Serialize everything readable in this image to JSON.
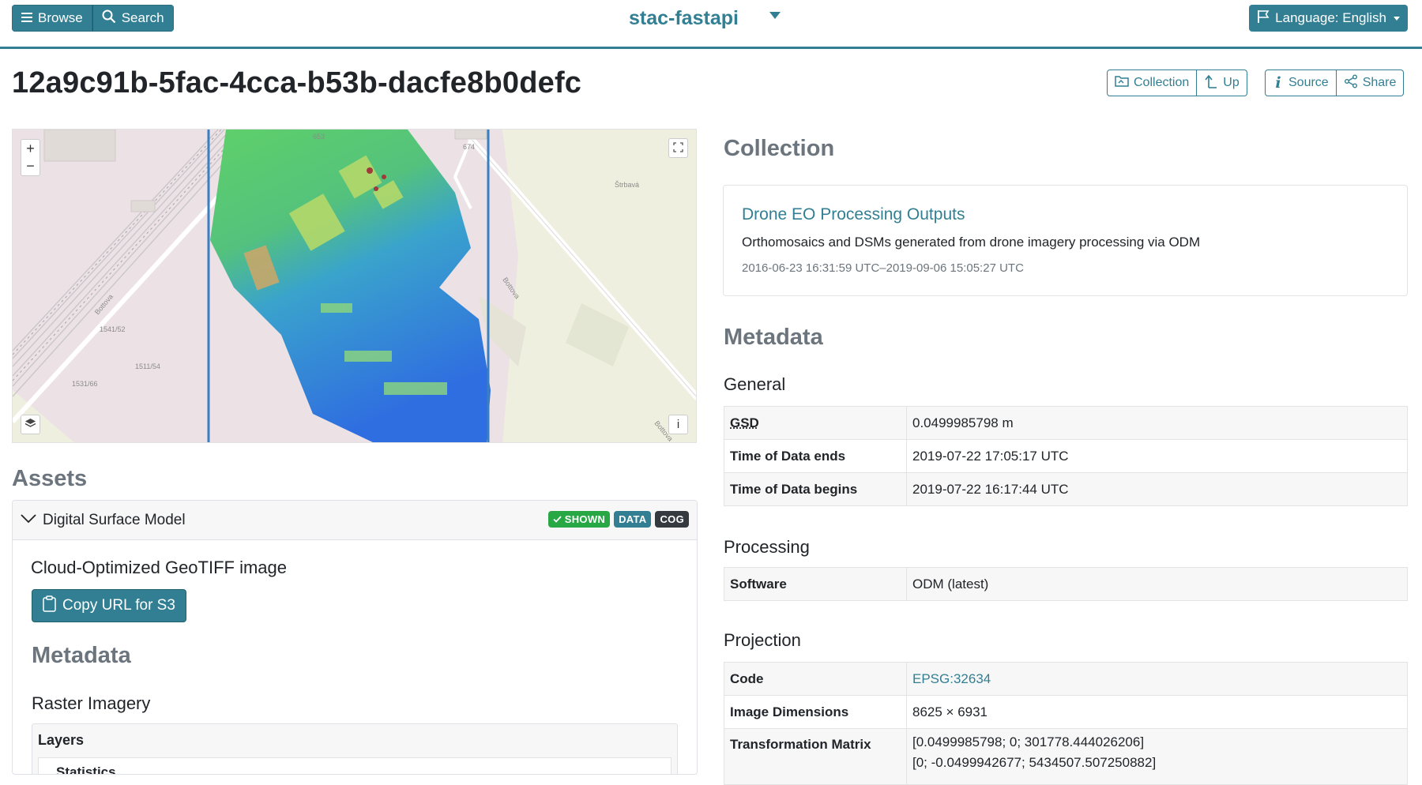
{
  "header": {
    "browse_label": "Browse",
    "search_label": "Search",
    "catalog_title": "stac-fastapi",
    "language_label": "Language: English"
  },
  "page": {
    "title": "12a9c91b-5fac-4cca-b53b-dacfe8b0defc",
    "actions": {
      "collection": "Collection",
      "up": "Up",
      "source": "Source",
      "share": "Share"
    }
  },
  "map": {
    "zoom_in": "+",
    "zoom_out": "−",
    "info": "i",
    "street_labels": [
      "Štrbavá",
      "Bottova",
      "Bottova",
      "Bottova"
    ],
    "parcel_labels": [
      "653",
      "674",
      "1541/52",
      "1511/54",
      "1531/66"
    ]
  },
  "assets": {
    "heading": "Assets",
    "items": [
      {
        "title": "Digital Surface Model",
        "badges": [
          "SHOWN",
          "DATA",
          "COG"
        ],
        "type": "Cloud-Optimized GeoTIFF image",
        "copy_label": "Copy URL for S3",
        "metadata_heading": "Metadata",
        "raster_heading": "Raster Imagery",
        "layers_label": "Layers",
        "statistics_label": "Statistics"
      }
    ]
  },
  "collection": {
    "heading": "Collection",
    "name": "Drone EO Processing Outputs",
    "description": "Orthomosaics and DSMs generated from drone imagery processing via ODM",
    "dates": "2016-06-23 16:31:59 UTC–2019-09-06 15:05:27 UTC"
  },
  "metadata": {
    "heading": "Metadata",
    "general": {
      "heading": "General",
      "rows": [
        {
          "key": "GSD",
          "value": "0.0499985798 m"
        },
        {
          "key": "Time of Data ends",
          "value": "2019-07-22 17:05:17 UTC"
        },
        {
          "key": "Time of Data begins",
          "value": "2019-07-22 16:17:44 UTC"
        }
      ]
    },
    "processing": {
      "heading": "Processing",
      "rows": [
        {
          "key": "Software",
          "value": "ODM (latest)"
        }
      ]
    },
    "projection": {
      "heading": "Projection",
      "rows": [
        {
          "key": "Code",
          "value": "EPSG:32634"
        },
        {
          "key": "Image Dimensions",
          "value": "8625 × 6931"
        },
        {
          "key": "Transformation Matrix",
          "value_lines": [
            "[0.0499985798; 0; 301778.444026206]",
            "[0; -0.0499942677; 5434507.507250882]"
          ]
        }
      ]
    }
  },
  "colors": {
    "accent": "#327f93",
    "badge_shown": "#28a745",
    "badge_data": "#327f93",
    "badge_cog": "#343a40",
    "muted": "#6c757d"
  }
}
